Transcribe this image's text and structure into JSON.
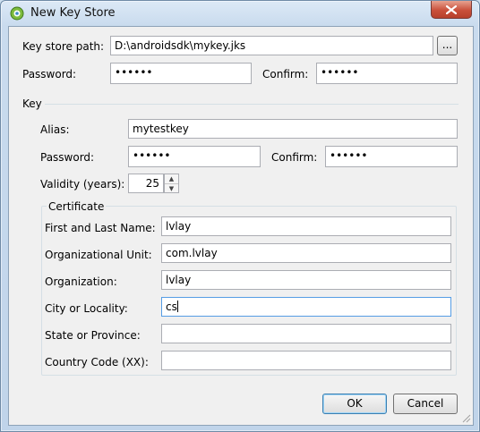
{
  "window": {
    "title": "New Key Store"
  },
  "keystore": {
    "path_label": "Key store path:",
    "path_value": "D:\\androidsdk\\mykey.jks",
    "browse_label": "...",
    "password_label": "Password:",
    "password_value": "••••••",
    "confirm_label": "Confirm:",
    "confirm_value": "••••••"
  },
  "key": {
    "section_label": "Key",
    "alias_label": "Alias:",
    "alias_value": "mytestkey",
    "password_label": "Password:",
    "password_value": "••••••",
    "confirm_label": "Confirm:",
    "confirm_value": "••••••",
    "validity_label": "Validity (years):",
    "validity_value": "25"
  },
  "certificate": {
    "group_label": "Certificate",
    "fields": [
      {
        "label": "First and Last Name:",
        "value": "lvlay"
      },
      {
        "label": "Organizational Unit:",
        "value": "com.lvlay"
      },
      {
        "label": "Organization:",
        "value": "lvlay"
      },
      {
        "label": "City or Locality:",
        "value": "cs"
      },
      {
        "label": "State or Province:",
        "value": ""
      },
      {
        "label": "Country Code (XX):",
        "value": ""
      }
    ]
  },
  "buttons": {
    "ok": "OK",
    "cancel": "Cancel"
  },
  "icons": {
    "app": "android-studio-icon",
    "close": "close-icon",
    "spin_up": "chevron-up-icon",
    "spin_down": "chevron-down-icon"
  },
  "colors": {
    "focus_border": "#569de5",
    "close_button": "#c9503b"
  }
}
